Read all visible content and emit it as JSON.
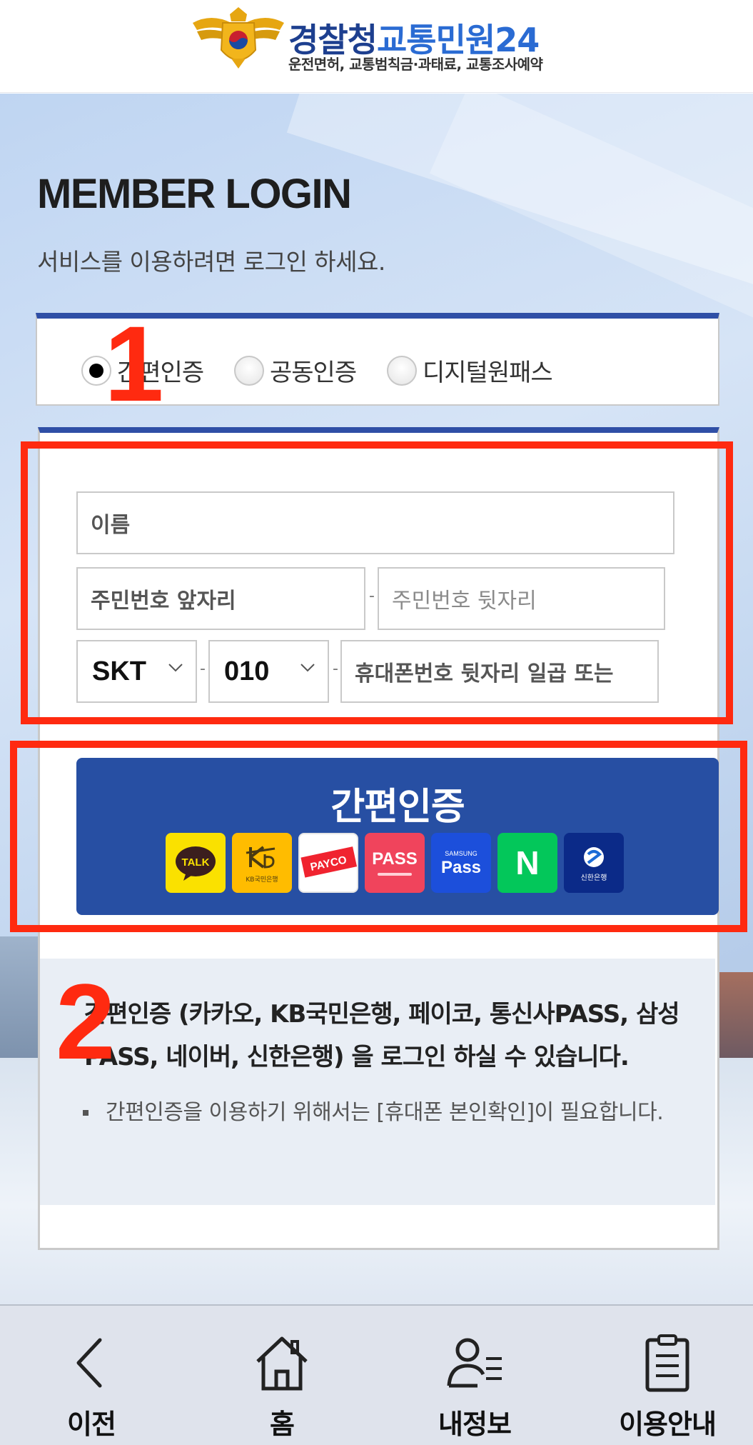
{
  "header": {
    "title_part1": "경찰청",
    "title_part2": "교통민원24",
    "subtitle": "운전면허, 교통범칙금·과태료, 교통조사예약"
  },
  "login": {
    "title": "MEMBER LOGIN",
    "subtitle": "서비스를 이용하려면 로그인 하세요."
  },
  "auth_methods": [
    {
      "label": "간편인증",
      "selected": true
    },
    {
      "label": "공동인증",
      "selected": false
    },
    {
      "label": "디지털원패스",
      "selected": false
    }
  ],
  "form": {
    "name_value": "이름",
    "rrn_front_value": "주민번호 앞자리",
    "rrn_back_placeholder": "주민번호 뒷자리",
    "carrier_selected": "SKT",
    "prefix_selected": "010",
    "phone_value": "휴대폰번호 뒷자리 일곱 또는",
    "separator": "-"
  },
  "auth_button": {
    "label": "간편인증",
    "providers": [
      {
        "name": "kakao-talk",
        "text": "TALK",
        "color": "#fae100"
      },
      {
        "name": "kb-bank",
        "text": "KB국민은행",
        "color": "#ffbc00"
      },
      {
        "name": "payco",
        "text": "PAYCO",
        "color": "#ffffff"
      },
      {
        "name": "pass",
        "text": "PASS",
        "color": "#f0445c"
      },
      {
        "name": "samsung-pass",
        "text": "Pass",
        "small": "SAMSUNG",
        "color": "#1c4fdb"
      },
      {
        "name": "naver",
        "text": "N",
        "color": "#03c75a"
      },
      {
        "name": "shinhan",
        "text": "신한은행",
        "color": "#0b2a88"
      }
    ]
  },
  "info": {
    "main": "간편인증 (카카오, KB국민은행, 페이코, 통신사PASS, 삼성PASS, 네이버, 신한은행) 을 로그인 하실 수 있습니다.",
    "bullet": "간편인증을 이용하기 위해서는 [휴대폰 본인확인]이 필요합니다."
  },
  "annotations": [
    "1",
    "2"
  ],
  "nav": [
    {
      "label": "이전",
      "icon": "back-chevron-icon"
    },
    {
      "label": "홈",
      "icon": "home-icon"
    },
    {
      "label": "내정보",
      "icon": "my-info-icon"
    },
    {
      "label": "이용안내",
      "icon": "guide-clipboard-icon"
    }
  ],
  "colors": {
    "brand_navy": "#1d3f8f",
    "brand_blue": "#2a6bd3",
    "button_blue": "#274fa3",
    "panel_border_top": "#2f4fa6",
    "annotation_red": "#ff2a10"
  }
}
